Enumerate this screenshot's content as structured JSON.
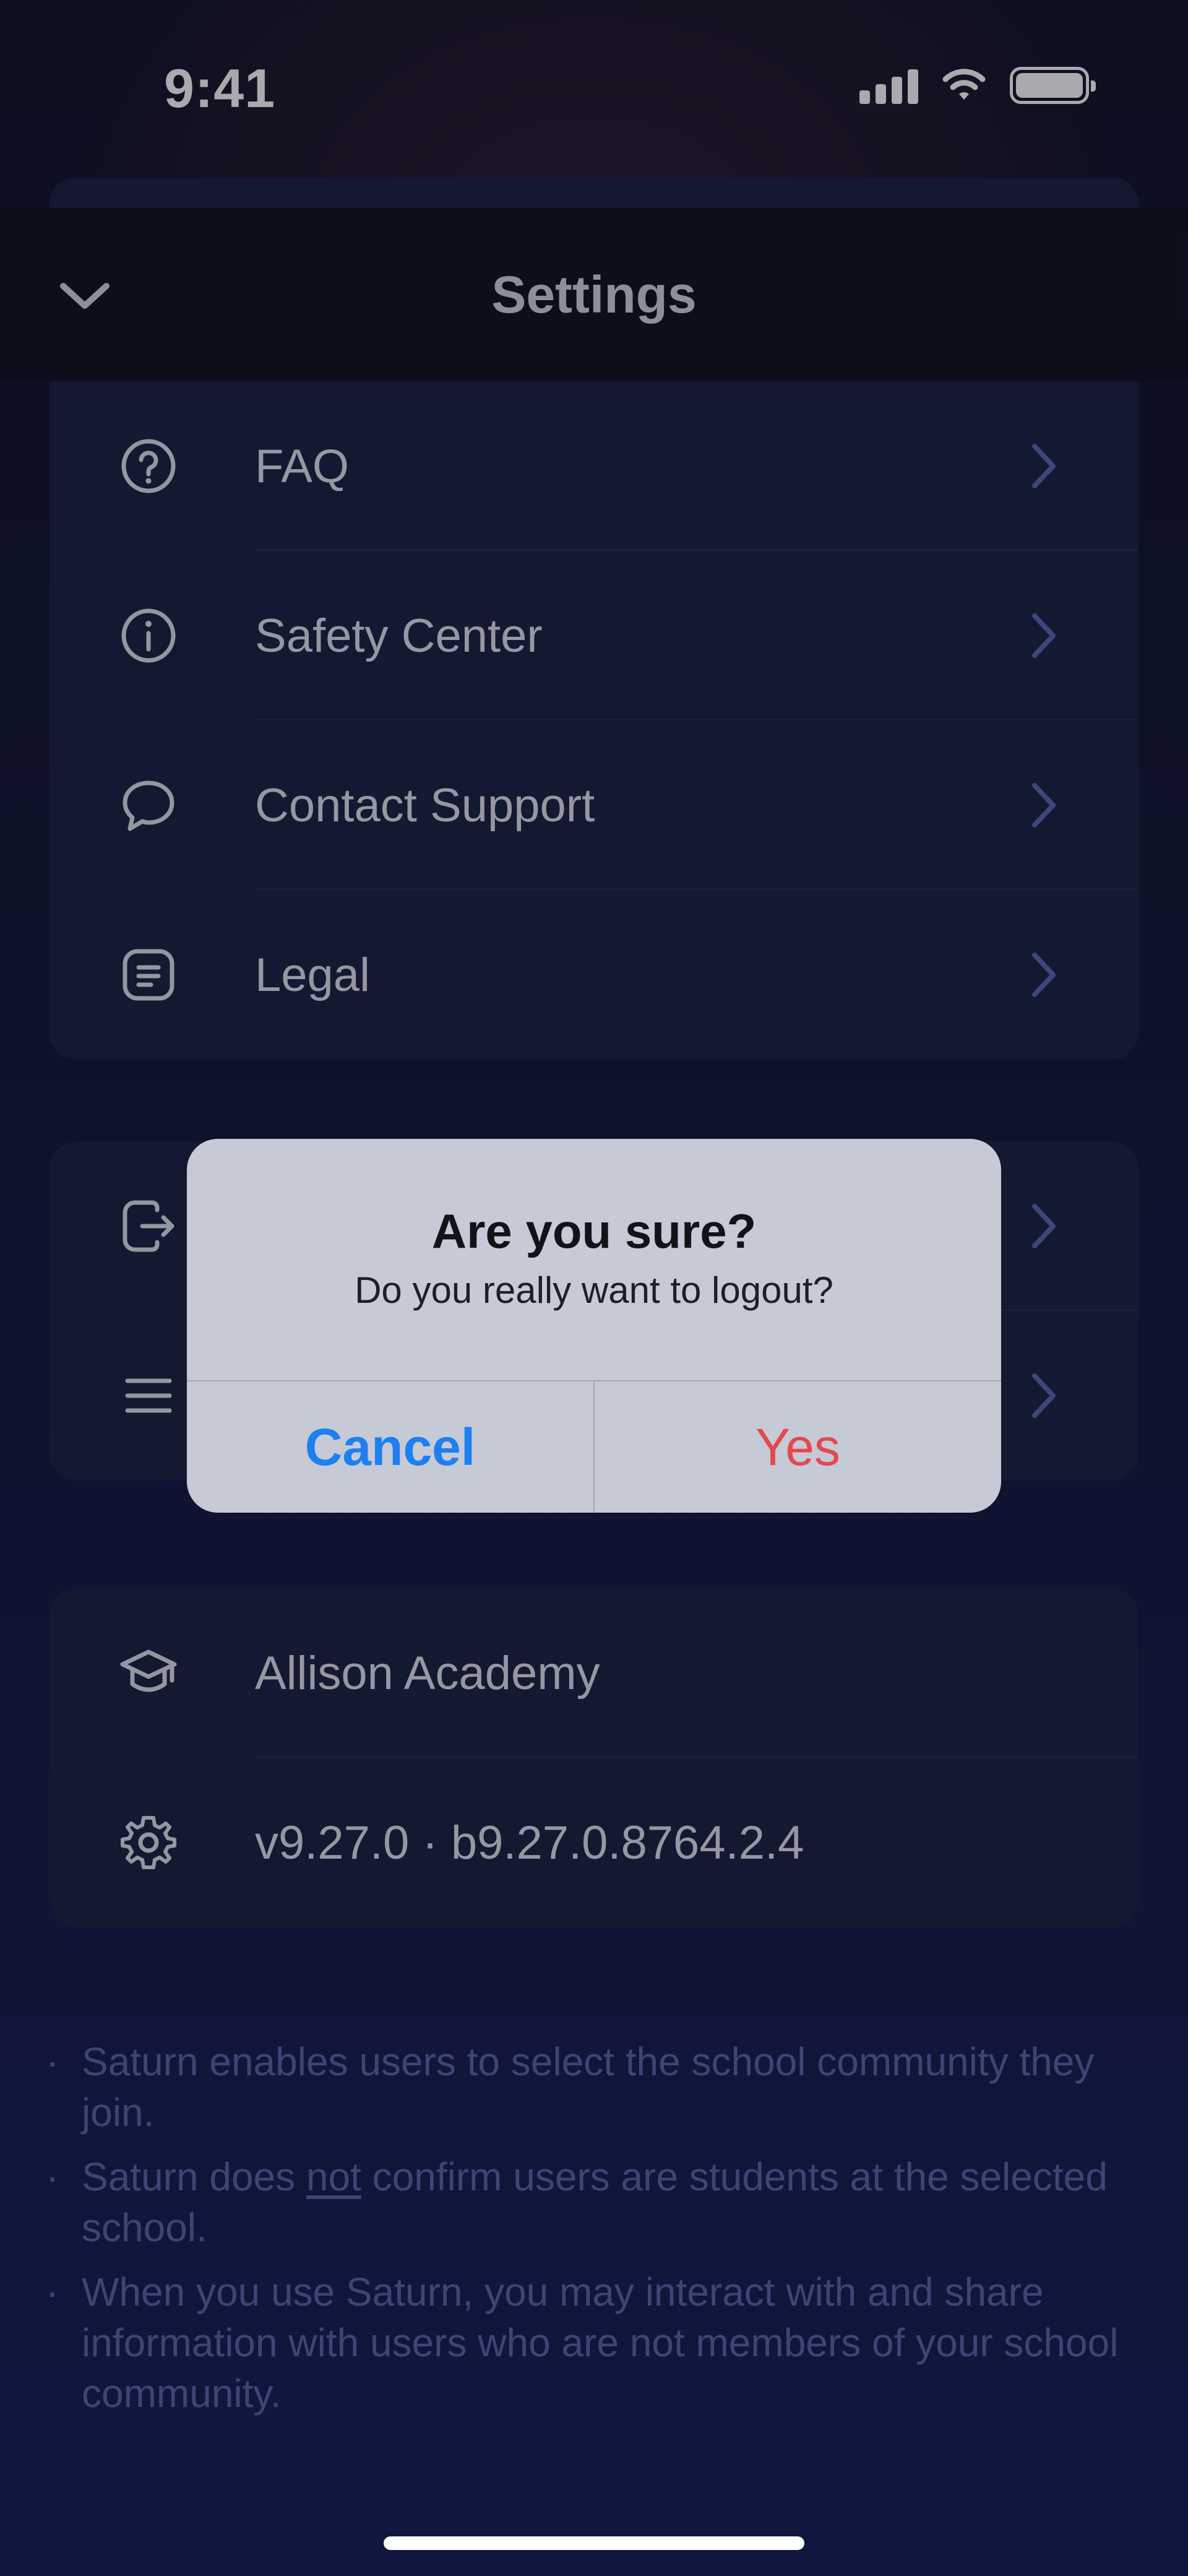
{
  "status_bar": {
    "time": "9:41"
  },
  "header": {
    "title": "Settings"
  },
  "support_menu": {
    "items": [
      {
        "label": "FAQ",
        "icon": "help-circle-icon"
      },
      {
        "label": "Safety Center",
        "icon": "info-circle-icon"
      },
      {
        "label": "Contact Support",
        "icon": "chat-bubble-icon"
      },
      {
        "label": "Legal",
        "icon": "document-icon"
      }
    ]
  },
  "account_menu": {
    "items": [
      {
        "label": "",
        "icon": "logout-icon"
      },
      {
        "label": "",
        "icon": "menu-lines-icon"
      }
    ]
  },
  "info_card": {
    "school": "Allison Academy",
    "version": "v9.27.0 · b9.27.0.8764.2.4"
  },
  "disclaimers": {
    "item1": "Saturn enables users to select the school community they join.",
    "item2_before": "Saturn does ",
    "item2_emphasis": "not",
    "item2_after": " confirm users are students at the selected school.",
    "item3": "When you use Saturn, you may interact with and share information with users who are not members of your school community."
  },
  "alert": {
    "title": "Are you sure?",
    "message": "Do you really want to logout?",
    "cancel_label": "Cancel",
    "confirm_label": "Yes"
  },
  "colors": {
    "accent_blue": "#1e7ff0",
    "destructive_red": "#e5484d",
    "chevron": "#5b68b4",
    "card_bg": "#1a2340"
  }
}
